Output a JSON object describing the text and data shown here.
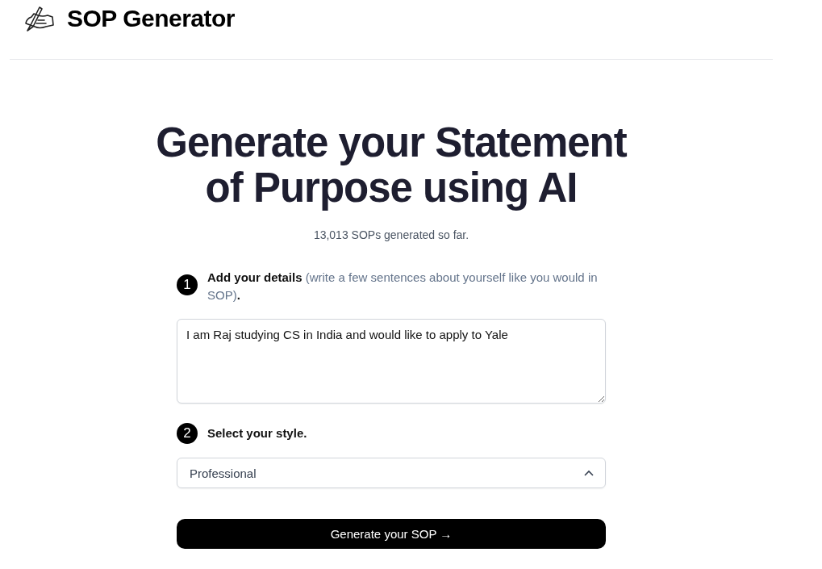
{
  "header": {
    "title": "SOP Generator"
  },
  "hero": {
    "title_lines": [
      "Generate your Statement",
      "of Purpose using AI"
    ],
    "counter": "13,013 SOPs generated so far."
  },
  "steps": [
    {
      "kind": "textarea",
      "number": "1",
      "label": "Add your details",
      "hint": "(write a few sentences about yourself like you would in SOP)",
      "suffix": ".",
      "value": "I am Raj studying CS in India and would like to apply to Yale"
    },
    {
      "kind": "select",
      "number": "2",
      "label": "Select your style.",
      "value": "Professional",
      "expanded": true
    }
  ],
  "submit": {
    "label": "Generate your SOP →"
  }
}
